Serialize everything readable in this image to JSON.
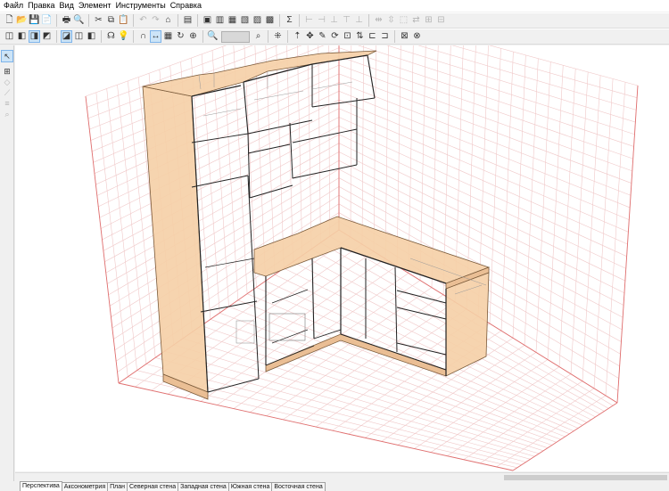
{
  "menu": [
    "Файл",
    "Правка",
    "Вид",
    "Элемент",
    "Инструменты",
    "Справка"
  ],
  "toolbar1": [
    {
      "icon": "new-file-icon",
      "glyph": "🗋"
    },
    {
      "icon": "open-folder-icon",
      "glyph": "📂"
    },
    {
      "icon": "save-icon",
      "glyph": "💾"
    },
    {
      "icon": "export-icon",
      "glyph": "📄"
    },
    {
      "sep": true
    },
    {
      "icon": "print-icon",
      "glyph": "🖶"
    },
    {
      "icon": "print-preview-icon",
      "glyph": "🔍"
    },
    {
      "sep": true
    },
    {
      "icon": "cut-icon",
      "glyph": "✂"
    },
    {
      "icon": "copy-icon",
      "glyph": "⧉"
    },
    {
      "icon": "paste-icon",
      "glyph": "📋"
    },
    {
      "sep": true
    },
    {
      "icon": "undo-icon",
      "glyph": "↶",
      "disabled": true
    },
    {
      "icon": "redo-icon",
      "glyph": "↷",
      "disabled": true
    },
    {
      "icon": "catalog-icon",
      "glyph": "⌂"
    },
    {
      "sep": true
    },
    {
      "icon": "properties-icon",
      "glyph": "▤"
    },
    {
      "sep": true
    },
    {
      "icon": "layout-1-icon",
      "glyph": "▣"
    },
    {
      "icon": "layout-2-icon",
      "glyph": "▥"
    },
    {
      "icon": "layout-3-icon",
      "glyph": "▦"
    },
    {
      "icon": "layout-4-icon",
      "glyph": "▧"
    },
    {
      "icon": "layout-5-icon",
      "glyph": "▨"
    },
    {
      "icon": "report-icon",
      "glyph": "▩"
    },
    {
      "sep": true
    },
    {
      "icon": "sum-icon",
      "glyph": "Σ"
    },
    {
      "sep": true
    },
    {
      "icon": "align-left-icon",
      "glyph": "⊢",
      "disabled": true
    },
    {
      "icon": "align-center-icon",
      "glyph": "⊣",
      "disabled": true
    },
    {
      "icon": "align-right-icon",
      "glyph": "⊥",
      "disabled": true
    },
    {
      "icon": "align-top-icon",
      "glyph": "⊤",
      "disabled": true
    },
    {
      "icon": "align-bottom-icon",
      "glyph": "⊥",
      "disabled": true
    },
    {
      "sep": true
    },
    {
      "icon": "distribute-h-icon",
      "glyph": "⇹",
      "disabled": true
    },
    {
      "icon": "distribute-v-icon",
      "glyph": "⇳",
      "disabled": true
    },
    {
      "icon": "size-icon",
      "glyph": "⬚",
      "disabled": true
    },
    {
      "icon": "mirror-icon",
      "glyph": "⇄",
      "disabled": true
    },
    {
      "icon": "group-icon",
      "glyph": "⊞",
      "disabled": true
    },
    {
      "icon": "ungroup-icon",
      "glyph": "⊟",
      "disabled": true
    }
  ],
  "toolbar2": [
    {
      "icon": "view-wire-icon",
      "glyph": "◫"
    },
    {
      "icon": "view-solid-icon",
      "glyph": "◧"
    },
    {
      "icon": "view-textured-icon",
      "glyph": "◨",
      "pressed": true
    },
    {
      "icon": "view-shaded-icon",
      "glyph": "◩"
    },
    {
      "sep": true
    },
    {
      "icon": "box-front-icon",
      "glyph": "◪",
      "pressed": true
    },
    {
      "icon": "box-back-icon",
      "glyph": "◫"
    },
    {
      "icon": "box-color-icon",
      "glyph": "◧"
    },
    {
      "sep": true
    },
    {
      "icon": "camera-icon",
      "glyph": "☊"
    },
    {
      "icon": "light-icon",
      "glyph": "💡"
    },
    {
      "sep": true
    },
    {
      "icon": "magnet-icon",
      "glyph": "∩"
    },
    {
      "icon": "dimensions-icon",
      "glyph": "↔",
      "pressed": true
    },
    {
      "icon": "grid-icon",
      "glyph": "▦"
    },
    {
      "icon": "rotate-icon",
      "glyph": "↻"
    },
    {
      "icon": "target-icon",
      "glyph": "⊕"
    },
    {
      "sep": true
    },
    {
      "icon": "zoom-icon",
      "glyph": "🔍",
      "zoom_after": true
    },
    {
      "icon": "zoom-extents-icon",
      "glyph": "⌕"
    },
    {
      "sep": true
    },
    {
      "icon": "snap-icon",
      "glyph": "⁜"
    },
    {
      "sep": true
    },
    {
      "icon": "move-up-icon",
      "glyph": "⇡"
    },
    {
      "icon": "move-icon",
      "glyph": "✥"
    },
    {
      "icon": "pencil-icon",
      "glyph": "✎"
    },
    {
      "icon": "rotate-2-icon",
      "glyph": "⟳"
    },
    {
      "icon": "lock-icon",
      "glyph": "⊡"
    },
    {
      "icon": "flip-icon",
      "glyph": "⇅"
    },
    {
      "icon": "step-icon",
      "glyph": "⊏"
    },
    {
      "icon": "level-icon",
      "glyph": "⊐"
    },
    {
      "sep": true
    },
    {
      "icon": "settings-icon",
      "glyph": "⊠"
    },
    {
      "icon": "delete-icon",
      "glyph": "⊗"
    }
  ],
  "left_toolbar": [
    {
      "icon": "select-arrow-icon",
      "glyph": "↖",
      "pressed": true
    },
    {
      "icon": "floor-plan-icon",
      "glyph": "⊞"
    },
    {
      "icon": "wall-icon",
      "glyph": "◇",
      "disabled": true
    },
    {
      "icon": "measure-icon",
      "glyph": "⟋",
      "disabled": true
    },
    {
      "icon": "dimension-tool-icon",
      "glyph": "≡",
      "disabled": true
    },
    {
      "icon": "zoom-tool-icon",
      "glyph": "⌕",
      "disabled": true
    }
  ],
  "tabs": [
    {
      "label": "Перспектива",
      "active": true
    },
    {
      "label": "Аксонометрия"
    },
    {
      "label": "План"
    },
    {
      "label": "Северная стена"
    },
    {
      "label": "Западная стена"
    },
    {
      "label": "Южная стена"
    },
    {
      "label": "Восточная стена"
    }
  ],
  "colors": {
    "wood": "#f5cfa6",
    "wood_edge": "#7a5a3a",
    "grid_line": "#f0c8c8",
    "room_edge": "#e07070",
    "line": "#222222"
  }
}
